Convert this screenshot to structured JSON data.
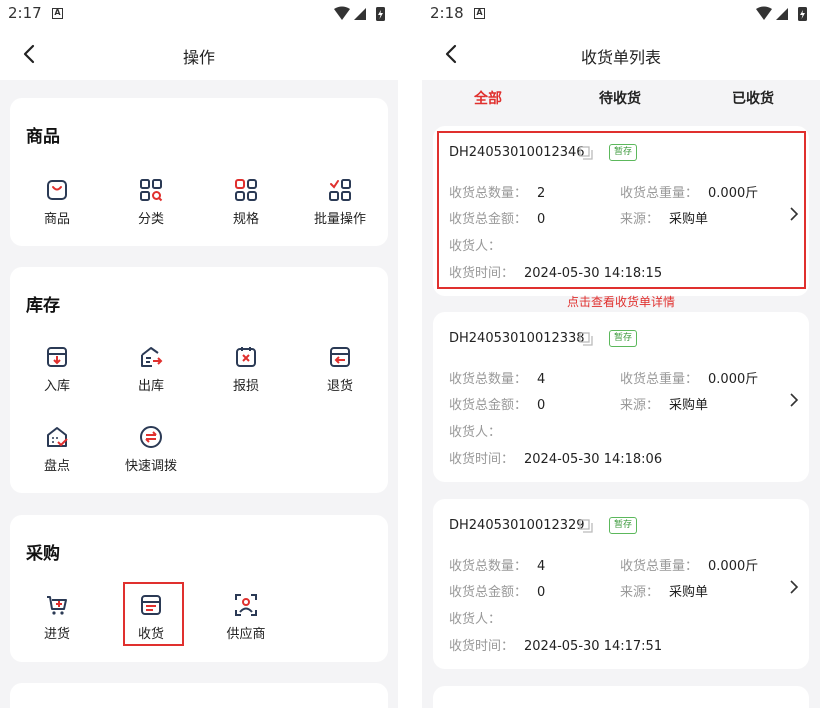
{
  "left": {
    "status_time": "2:17",
    "status_a": "A",
    "title": "操作",
    "sections": [
      {
        "title": "商品",
        "items": [
          "商品",
          "分类",
          "规格",
          "批量操作"
        ]
      },
      {
        "title": "库存",
        "items": [
          "入库",
          "出库",
          "报损",
          "退货",
          "盘点",
          "快速调拨"
        ]
      },
      {
        "title": "采购",
        "items": [
          "进货",
          "收货",
          "供应商"
        ]
      }
    ]
  },
  "right": {
    "status_time": "2:18",
    "status_a": "A",
    "title": "收货单列表",
    "tabs": [
      "全部",
      "待收货",
      "已收货"
    ],
    "active_tab": "全部",
    "hint": "点击查看收货单详情",
    "labels": {
      "qty": "收货总数量：",
      "weight": "收货总重量：",
      "amount": "收货总金额：",
      "source": "来源：",
      "receiver": "收货人：",
      "time": "收货时间："
    },
    "orders": [
      {
        "code": "DH24053010012346",
        "badge": "暂存",
        "qty": "2",
        "weight": "0.000斤",
        "amount": "0",
        "source": "采购单",
        "receiver": "",
        "time": "2024-05-30 14:18:15"
      },
      {
        "code": "DH24053010012338",
        "badge": "暂存",
        "qty": "4",
        "weight": "0.000斤",
        "amount": "0",
        "source": "采购单",
        "receiver": "",
        "time": "2024-05-30 14:18:06"
      },
      {
        "code": "DH24053010012329",
        "badge": "暂存",
        "qty": "4",
        "weight": "0.000斤",
        "amount": "0",
        "source": "采购单",
        "receiver": "",
        "time": "2024-05-30 14:17:51"
      }
    ]
  },
  "colors": {
    "accent": "#e0302e",
    "icon_dark": "#2b3a55",
    "badge_green": "#5cb85c"
  }
}
